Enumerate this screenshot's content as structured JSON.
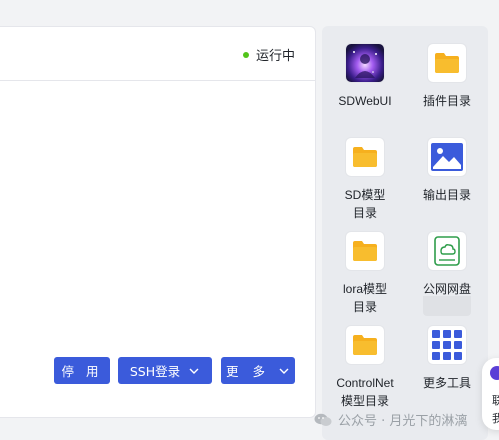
{
  "status": {
    "label": "运行中",
    "color": "#52c41a"
  },
  "actions": {
    "stop": "停 用",
    "ssh": "SSH登录",
    "more": "更 多"
  },
  "apps": [
    {
      "label": "SDWebUI",
      "icon": "sdwebui-logo"
    },
    {
      "label": "插件目录",
      "icon": "folder-icon"
    },
    {
      "label": "SD模型\n目录",
      "icon": "folder-icon"
    },
    {
      "label": "输出目录",
      "icon": "image-icon"
    },
    {
      "label": "lora模型\n目录",
      "icon": "folder-icon"
    },
    {
      "label": "公网网盘",
      "icon": "cloud-drive-icon"
    },
    {
      "label": "ControlNet\n模型目录",
      "icon": "folder-icon"
    },
    {
      "label": "更多工具",
      "icon": "grid-icon"
    }
  ],
  "watermark": {
    "text": "公众号 · 月光下的淋漓"
  },
  "chat": {
    "line1": "联",
    "line2": "我"
  },
  "colors": {
    "primary": "#3b5bdb",
    "folder": "#f6b01e",
    "success": "#52c41a"
  }
}
